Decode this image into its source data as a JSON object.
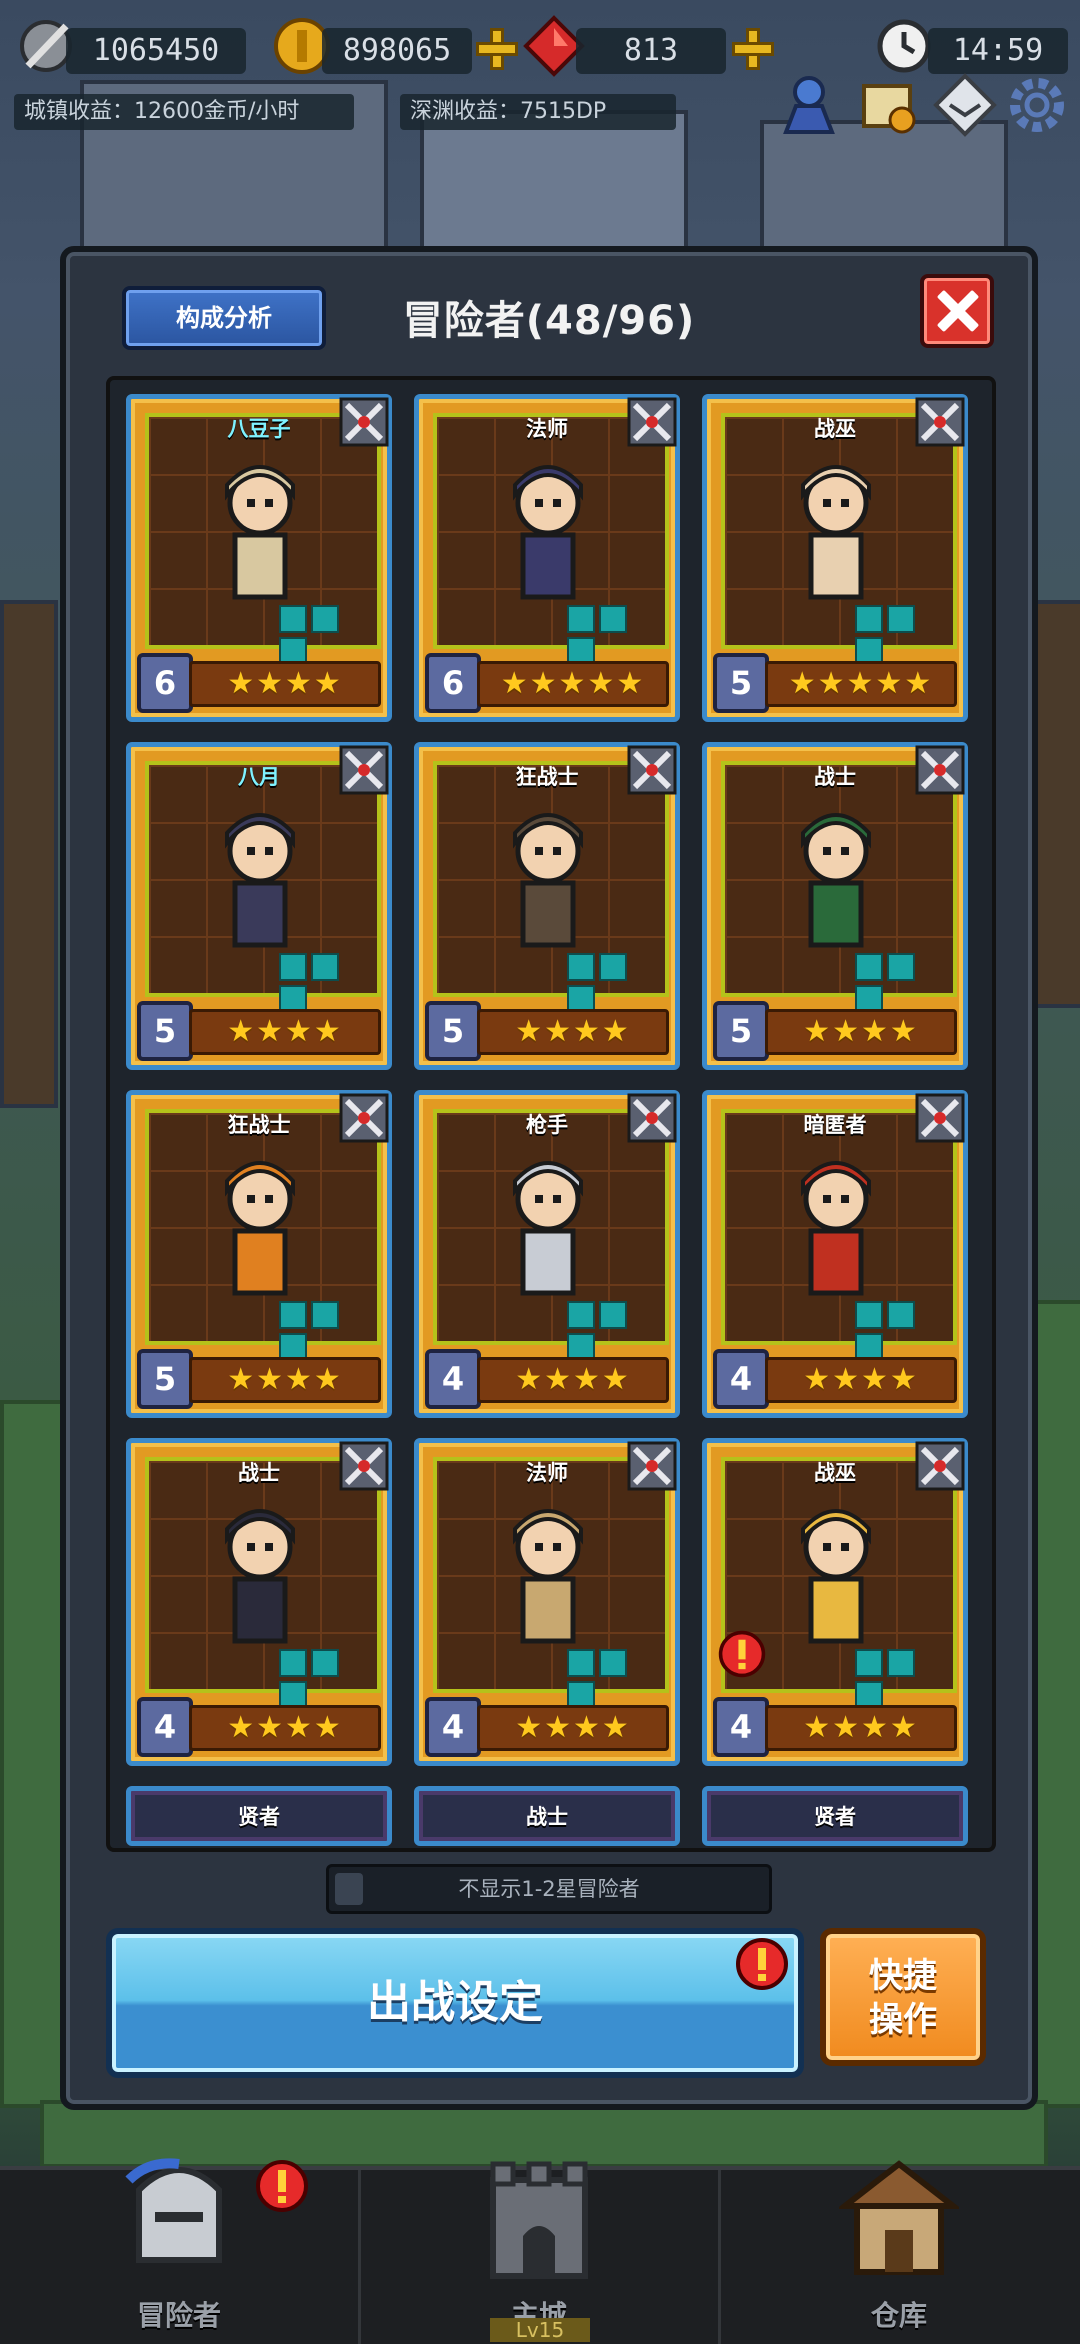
{
  "hud": {
    "power": "1065450",
    "gold": "898065",
    "gems": "813",
    "clock": "14:59",
    "town_income": "城镇收益：12600金币/小时",
    "abyss_income": "深渊收益：7515DP"
  },
  "panel": {
    "analysis_button": "构成分析",
    "title": "冒险者(48/96)"
  },
  "heroes": [
    {
      "cls": "八豆子",
      "level": "6",
      "stars": "★★★★",
      "color": "#d8c8a0"
    },
    {
      "cls": "法师",
      "level": "6",
      "stars": "★★★★★",
      "color": "#3a3a6a"
    },
    {
      "cls": "战巫",
      "level": "5",
      "stars": "★★★★★",
      "color": "#e8d0b0"
    },
    {
      "cls": "八月",
      "level": "5",
      "stars": "★★★★",
      "color": "#3a3a5a"
    },
    {
      "cls": "狂战士",
      "level": "5",
      "stars": "★★★★",
      "color": "#5a4a3a"
    },
    {
      "cls": "战士",
      "level": "5",
      "stars": "★★★★",
      "color": "#2a6a3a"
    },
    {
      "cls": "狂战士",
      "level": "5",
      "stars": "★★★★",
      "color": "#e08020"
    },
    {
      "cls": "枪手",
      "level": "4",
      "stars": "★★★★",
      "color": "#c8ccd4"
    },
    {
      "cls": "暗匿者",
      "level": "4",
      "stars": "★★★★",
      "color": "#c03020"
    },
    {
      "cls": "战士",
      "level": "4",
      "stars": "★★★★",
      "color": "#2a2a3a"
    },
    {
      "cls": "法师",
      "level": "4",
      "stars": "★★★★",
      "color": "#c8a870"
    },
    {
      "cls": "战巫",
      "level": "4",
      "stars": "★★★★",
      "color": "#e8b840"
    }
  ],
  "partial_heroes": [
    "贤者",
    "战士",
    "贤者"
  ],
  "toggle_label": "不显示1-2星冒险者",
  "battle_button": "出战设定",
  "quick_button_line1": "快捷",
  "quick_button_line2": "操作",
  "nav": {
    "adventurers": "冒险者",
    "main_city": "主城",
    "main_city_level": "Lv15",
    "warehouse": "仓库"
  },
  "colors": {
    "card_orange": "#e29a22",
    "card_border": "#3b8acb",
    "star": "#ffc91e",
    "battle_blue": "#5cc0ea",
    "quick_orange": "#f08a1e",
    "close_red": "#d9322b"
  }
}
